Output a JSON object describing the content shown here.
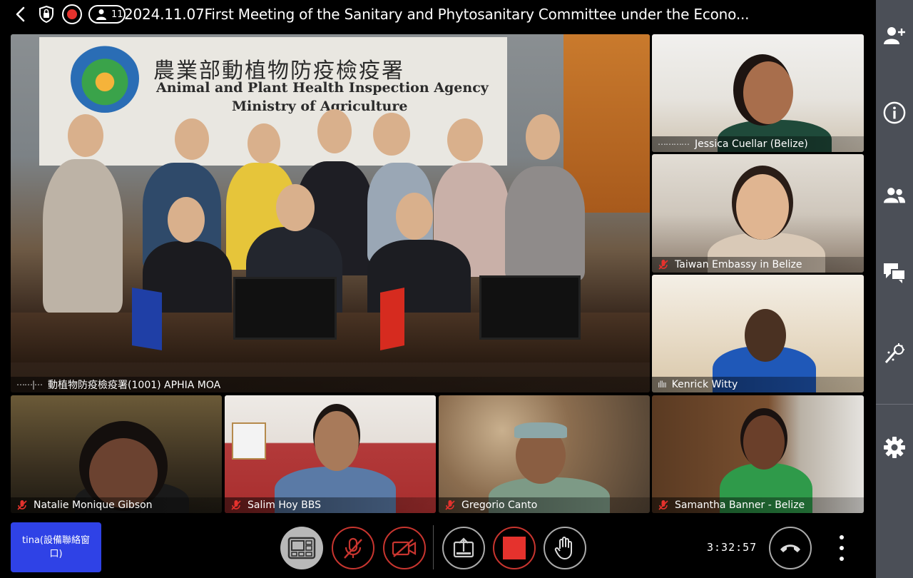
{
  "header": {
    "participant_count": "11",
    "title": "2024.11.07First Meeting of the Sanitary and Phytosanitary Committee under the Econo..."
  },
  "main_tile": {
    "name": "動植物防疫檢疫署(1001) APHIA MOA",
    "banner_cn": "農業部動植物防疫檢疫署",
    "banner_en1": "Animal and Plant Health Inspection Agency",
    "banner_en2": "Ministry of Agriculture"
  },
  "participants": [
    {
      "name": "Jessica Cuellar (Belize)",
      "status": "speaking"
    },
    {
      "name": "Taiwan Embassy in Belize",
      "status": "muted"
    },
    {
      "name": "Kenrick Witty",
      "status": "speaking"
    },
    {
      "name": "Natalie Monique Gibson",
      "status": "muted"
    },
    {
      "name": "Salim Hoy BBS",
      "status": "muted"
    },
    {
      "name": "Gregorio Canto",
      "status": "muted"
    },
    {
      "name": "Samantha Banner - Belize",
      "status": "muted"
    }
  ],
  "self_tile": {
    "name": "tina(設備聯絡窗口)"
  },
  "controls": {
    "timer": "3:32:57"
  },
  "sidebar": {
    "icons": [
      "add-participant-icon",
      "info-icon",
      "participants-icon",
      "chat-icon",
      "effects-icon",
      "settings-icon"
    ]
  },
  "colors": {
    "accent": "#2f42e6",
    "danger": "#e5322d",
    "sidebar_bg": "#4b4f57"
  }
}
